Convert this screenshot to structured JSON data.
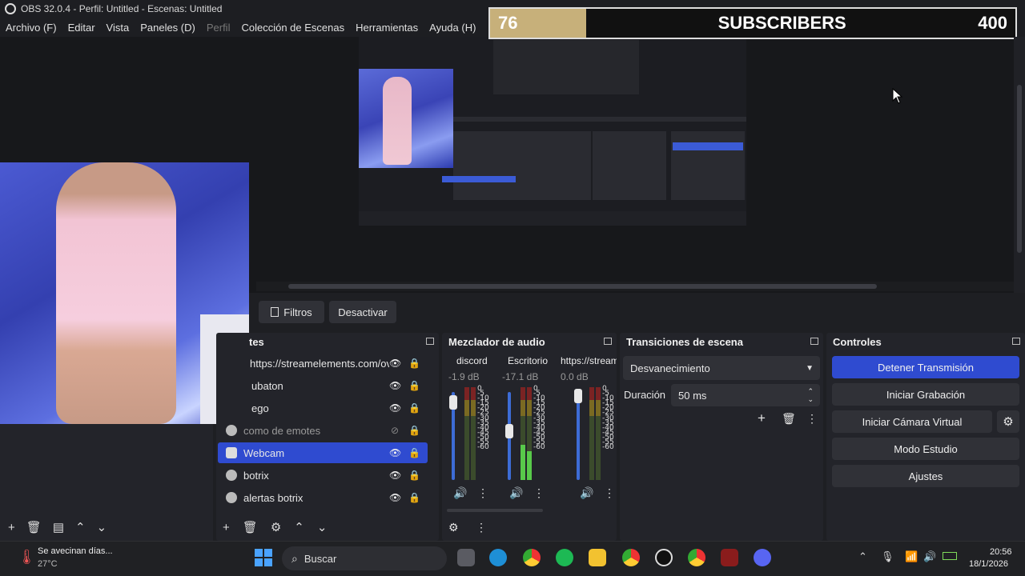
{
  "window": {
    "title": "OBS 32.0.4 - Perfil: Untitled - Escenas: Untitled"
  },
  "menu": [
    "Archivo (F)",
    "Editar",
    "Vista",
    "Paneles (D)",
    "Perfil",
    "Colección de Escenas",
    "Herramientas",
    "Ayuda (H)"
  ],
  "overlay": {
    "count": "76",
    "label": "SUBSCRIBERS",
    "goal": "400",
    "progress_fraction": 0.19
  },
  "source_toolbar": {
    "filters": "Filtros",
    "deactivate": "Desactivar"
  },
  "sources": {
    "title": "tes",
    "items": [
      {
        "label": "https://streamelements.com/ov",
        "visible": true,
        "state": "normal"
      },
      {
        "label": "ubaton",
        "visible": true,
        "state": "normal"
      },
      {
        "label": "ego",
        "visible": true,
        "state": "normal"
      },
      {
        "label": "como de emotes",
        "visible": false,
        "state": "dim"
      },
      {
        "label": "Webcam",
        "visible": true,
        "state": "selected"
      },
      {
        "label": "botrix",
        "visible": true,
        "state": "normal"
      },
      {
        "label": "alertas botrix",
        "visible": true,
        "state": "normal"
      }
    ]
  },
  "audio_mixer": {
    "title": "Mezclador de audio",
    "channels": [
      {
        "name": "discord",
        "db": "-1.9 dB",
        "level": 0.0,
        "fader": 0.9
      },
      {
        "name": "Escritorio",
        "db": "-17.1 dB",
        "level": 0.4,
        "fader": 0.55
      },
      {
        "name": "https://stream",
        "db": "0.0 dB",
        "level": 0.0,
        "fader": 0.95
      }
    ],
    "scale": [
      "0",
      "-5",
      "-10",
      "-15",
      "-20",
      "-25",
      "-30",
      "-35",
      "-40",
      "-45",
      "-50",
      "-55",
      "-60"
    ]
  },
  "transitions": {
    "title": "Transiciones de escena",
    "selected": "Desvanecimiento",
    "duration_label": "Duración",
    "duration_value": "50 ms"
  },
  "controls": {
    "title": "Controles",
    "stop_stream": "Detener Transmisión",
    "start_recording": "Iniciar Grabación",
    "virtual_cam": "Iniciar Cámara Virtual",
    "studio_mode": "Modo Estudio",
    "settings": "Ajustes"
  },
  "taskbar": {
    "weather_title": "Se avecinan días...",
    "weather_temp": "27°C",
    "search": "Buscar",
    "time": "20:56",
    "date": "18/1/2026"
  },
  "colors": {
    "accent": "#2f4bd0",
    "panel": "#23242a",
    "background": "#1e1f23"
  }
}
